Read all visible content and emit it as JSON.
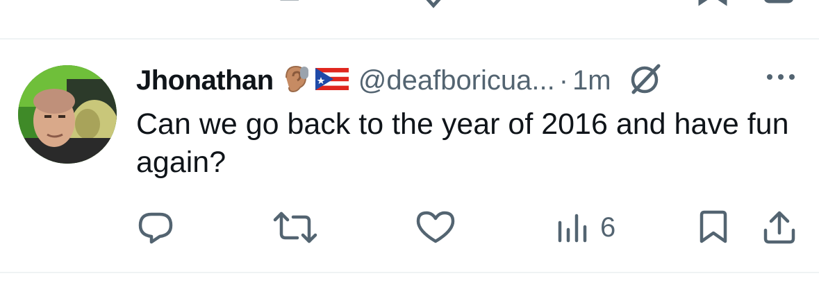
{
  "previous_tweet": {
    "icons": [
      "reply-icon",
      "retweet-icon",
      "like-icon",
      "views-icon",
      "bookmark-icon",
      "share-icon"
    ]
  },
  "tweet": {
    "author_name": "Jhonathan",
    "author_emojis": [
      "ear-with-hearing-aid-emoji",
      "puerto-rico-flag-emoji"
    ],
    "handle": "@deafboricua...",
    "separator": "·",
    "timestamp": "1m",
    "text": "Can we go back to the year of 2016 and have fun again?",
    "actions": {
      "reply": {
        "icon": "reply-icon",
        "count": ""
      },
      "retweet": {
        "icon": "retweet-icon",
        "count": ""
      },
      "like": {
        "icon": "heart-icon",
        "count": ""
      },
      "views": {
        "icon": "views-icon",
        "count": "6"
      },
      "bookmark": {
        "icon": "bookmark-icon",
        "count": ""
      },
      "share": {
        "icon": "share-icon",
        "count": ""
      }
    }
  },
  "colors": {
    "text_primary": "#0f1419",
    "text_secondary": "#536471",
    "divider": "#eff3f4",
    "background": "#ffffff"
  }
}
